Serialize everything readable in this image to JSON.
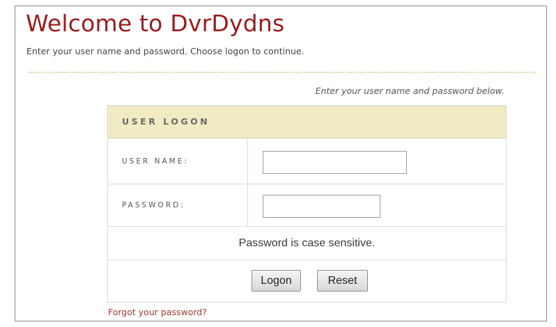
{
  "header": {
    "title": "Welcome to DvrDydns",
    "subtitle": "Enter your user name and password. Choose logon to continue."
  },
  "form": {
    "instruction": "Enter your user name and password below.",
    "section_title": "USER LOGON",
    "username": {
      "label": "USER NAME:",
      "value": ""
    },
    "password": {
      "label": "PASSWORD:",
      "value": ""
    },
    "note": "Password is case sensitive.",
    "logon_label": "Logon",
    "reset_label": "Reset",
    "forgot_link": "Forgot your password?"
  },
  "colors": {
    "title": "#9b1c1f",
    "header_band": "#f0ebc3",
    "link": "#a33a2c",
    "divider": "#e3d49a"
  }
}
